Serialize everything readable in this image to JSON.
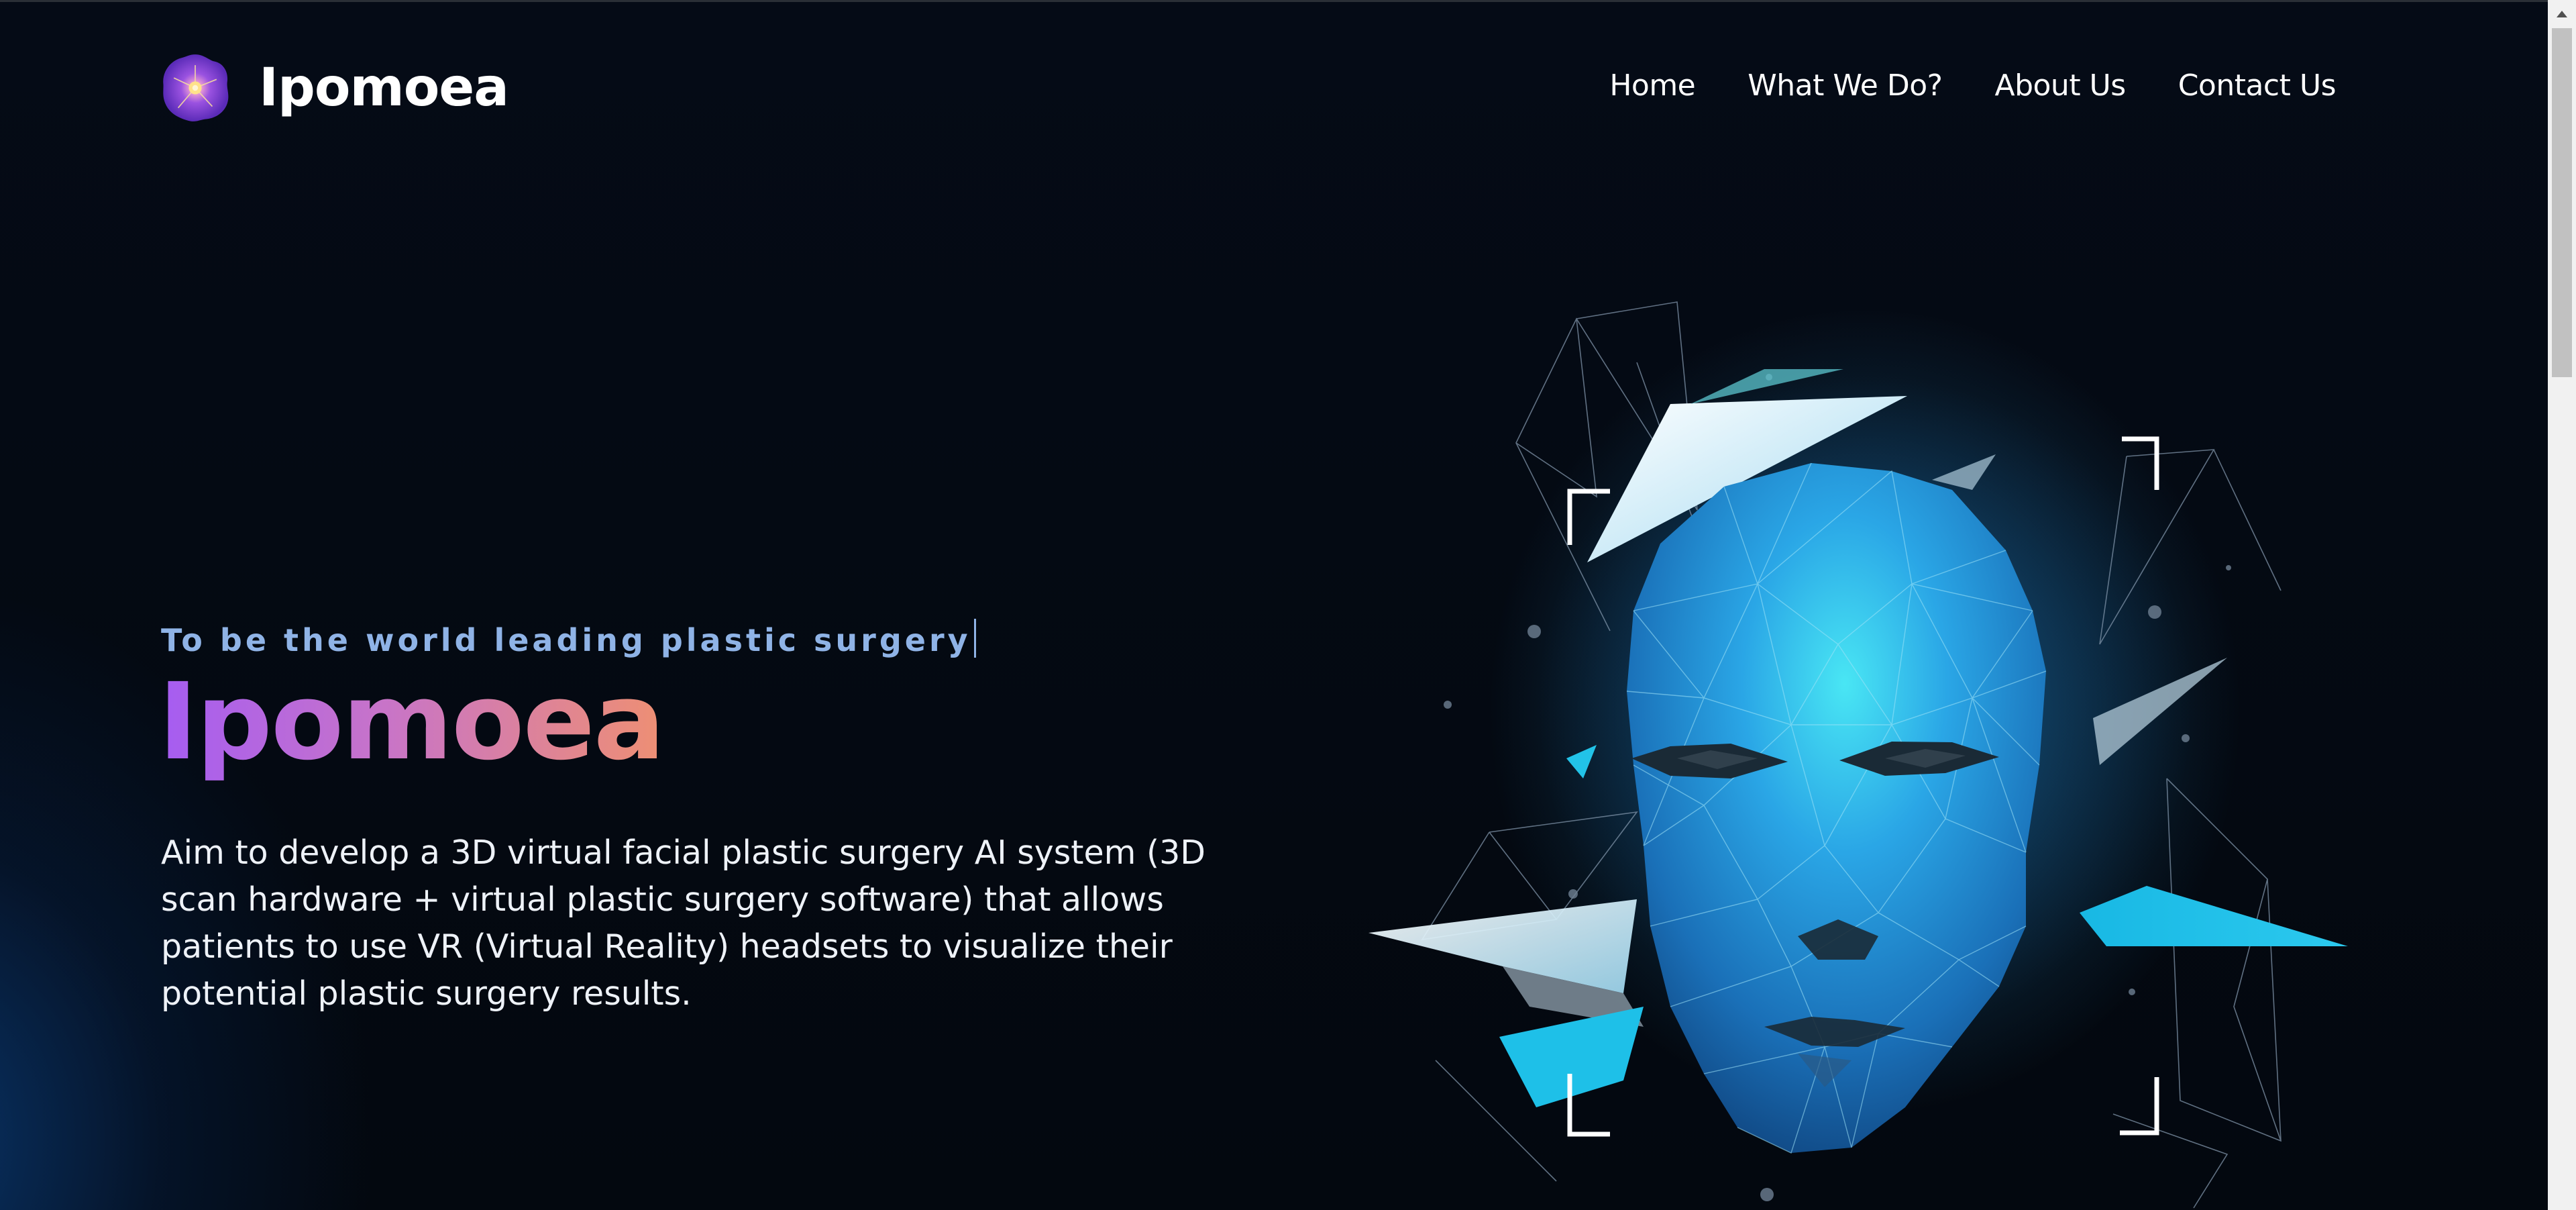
{
  "header": {
    "brand": "Ipomoea",
    "logo_icon": "morning-glory-flower-icon",
    "nav": [
      {
        "label": "Home"
      },
      {
        "label": "What We Do?"
      },
      {
        "label": "About Us"
      },
      {
        "label": "Contact Us"
      }
    ]
  },
  "hero": {
    "tagline": "To be the world leading plastic surgery",
    "title": "Ipomoea",
    "description": "Aim to develop a 3D virtual facial plastic surgery AI system (3D scan hardware + virtual plastic surgery software) that allows patients to use VR (Virtual Reality) headsets to visualize their potential plastic surgery results.",
    "illustration": "polygonal-3d-face-scan-icon"
  },
  "colors": {
    "background": "#040a14",
    "tagline": "#8fb3e6",
    "title_gradient_start": "#a55cf2",
    "title_gradient_end": "#ee8f73",
    "face_blue": "#2a9fe0",
    "accent_cyan": "#22c3e8"
  }
}
